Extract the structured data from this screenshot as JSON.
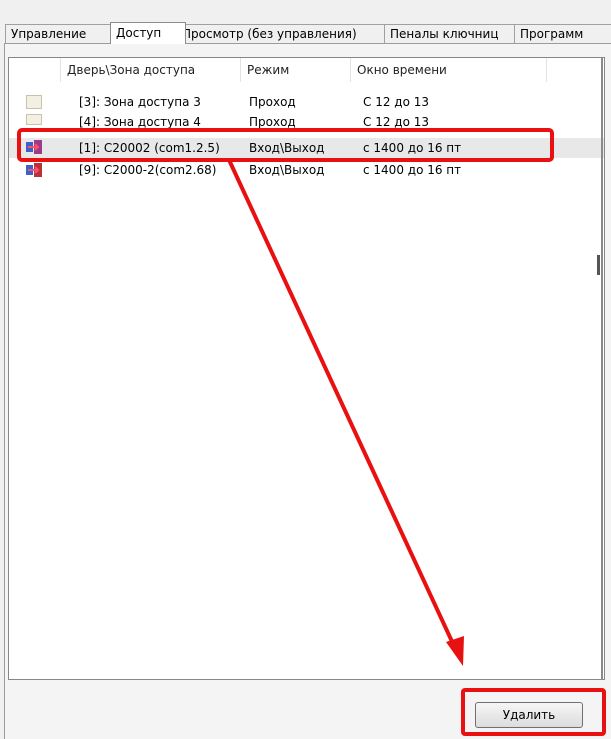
{
  "tabs": [
    "Управление",
    "Доступ",
    "Просмотр (без управления)",
    "Пеналы ключниц",
    "Программ"
  ],
  "active_tab_index": 1,
  "list": {
    "columns": [
      "Дверь\\Зона доступа",
      "Режим",
      "Окно времени"
    ],
    "rows": [
      {
        "icon": "access-zone-icon",
        "name": "[3]: Зона доступа 3",
        "mode": "Проход",
        "window": "С 12 до 13"
      },
      {
        "icon": "access-zone-icon",
        "name": "[4]: Зона доступа 4",
        "mode": "Проход",
        "window": "С 12 до 13"
      },
      {
        "icon": "door-controller-icon",
        "name": "[1]: С20002 (com1.2.5)",
        "mode": "Вход\\Выход",
        "window": "с 1400 до 16 пт"
      },
      {
        "icon": "door-controller-icon",
        "name": "[9]: С2000-2(com2.68)",
        "mode": "Вход\\Выход",
        "window": "с 1400 до 16 пт"
      }
    ],
    "selected_row_index": 2
  },
  "buttons": {
    "delete": "Удалить"
  },
  "colors": {
    "annotation": "#e81010",
    "selection": "#e8e8e8"
  }
}
